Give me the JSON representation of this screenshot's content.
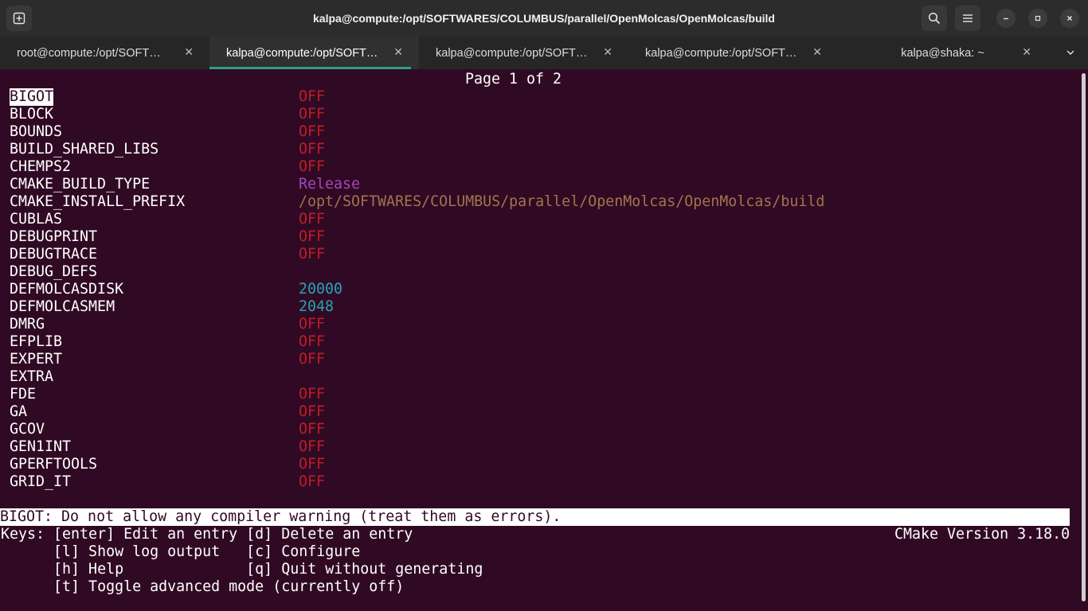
{
  "window": {
    "title": "kalpa@compute:/opt/SOFTWARES/COLUMBUS/parallel/OpenMolcas/OpenMolcas/build"
  },
  "tabs": [
    {
      "label": "root@compute:/opt/SOFT…",
      "active": false
    },
    {
      "label": "kalpa@compute:/opt/SOFT…",
      "active": true
    },
    {
      "label": "kalpa@compute:/opt/SOFT…",
      "active": false
    },
    {
      "label": "kalpa@compute:/opt/SOFT…",
      "active": false
    },
    {
      "label": "kalpa@shaka: ~",
      "active": false
    }
  ],
  "terminal": {
    "page_indicator": "Page 1 of 2",
    "entries": [
      {
        "name": "BIGOT",
        "value": "OFF"
      },
      {
        "name": "BLOCK",
        "value": "OFF"
      },
      {
        "name": "BOUNDS",
        "value": "OFF"
      },
      {
        "name": "BUILD_SHARED_LIBS",
        "value": "OFF"
      },
      {
        "name": "CHEMPS2",
        "value": "OFF"
      },
      {
        "name": "CMAKE_BUILD_TYPE",
        "value": "Release"
      },
      {
        "name": "CMAKE_INSTALL_PREFIX",
        "value": "/opt/SOFTWARES/COLUMBUS/parallel/OpenMolcas/OpenMolcas/build"
      },
      {
        "name": "CUBLAS",
        "value": "OFF"
      },
      {
        "name": "DEBUGPRINT",
        "value": "OFF"
      },
      {
        "name": "DEBUGTRACE",
        "value": "OFF"
      },
      {
        "name": "DEBUG_DEFS",
        "value": ""
      },
      {
        "name": "DEFMOLCASDISK",
        "value": "20000"
      },
      {
        "name": "DEFMOLCASMEM",
        "value": "2048"
      },
      {
        "name": "DMRG",
        "value": "OFF"
      },
      {
        "name": "EFPLIB",
        "value": "OFF"
      },
      {
        "name": "EXPERT",
        "value": "OFF"
      },
      {
        "name": "EXTRA",
        "value": ""
      },
      {
        "name": "FDE",
        "value": "OFF"
      },
      {
        "name": "GA",
        "value": "OFF"
      },
      {
        "name": "GCOV",
        "value": "OFF"
      },
      {
        "name": "GEN1INT",
        "value": "OFF"
      },
      {
        "name": "GPERFTOOLS",
        "value": "OFF"
      },
      {
        "name": "GRID_IT",
        "value": "OFF"
      }
    ],
    "help_text": "BIGOT: Do not allow any compiler warning (treat them as errors).",
    "keys_line1": "Keys: [enter] Edit an entry [d] Delete an entry",
    "version": "CMake Version 3.18.0",
    "keys_line2": "      [l] Show log output   [c] Configure",
    "keys_line3": "      [h] Help              [q] Quit without generating",
    "keys_line4": "      [t] Toggle advanced mode (currently off)"
  },
  "colors": {
    "background": "#300a24",
    "off": "#c01c28",
    "string": "#a347ba",
    "path": "#a2734c",
    "number": "#2aa1b3"
  },
  "icons": {
    "new_tab": "new-tab-icon",
    "search": "search-icon",
    "menu": "hamburger-menu-icon",
    "minimize": "minimize-icon",
    "maximize": "maximize-icon",
    "close": "close-icon"
  }
}
